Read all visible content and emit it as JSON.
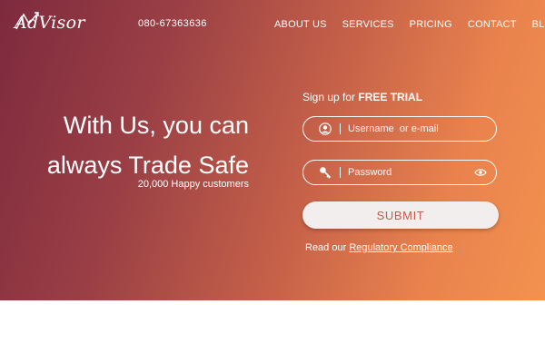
{
  "brand": {
    "logo_text": "AdVisor"
  },
  "header": {
    "phone": "080-67363636",
    "nav": [
      {
        "label": "ABOUT US"
      },
      {
        "label": "SERVICES"
      },
      {
        "label": "PRICING"
      },
      {
        "label": "CONTACT"
      },
      {
        "label": "BLOG"
      }
    ]
  },
  "hero": {
    "headline_line1": "With Us, you can",
    "headline_line2": "always Trade Safe",
    "subline": "20,000 Happy customers"
  },
  "form": {
    "signup_prefix": "Sign up for ",
    "signup_bold": "FREE TRIAL",
    "username_placeholder": "Username  or e-mail",
    "password_placeholder": "Password",
    "submit_label": "SUBMIT",
    "reg_prefix": "Read our ",
    "reg_link": "Regulatory Compliance",
    "user_icon": "user-icon",
    "key_icon": "key-icon",
    "eye_icon": "eye-icon"
  },
  "colors": {
    "gradient_start": "#7e2a3e",
    "gradient_end": "#f3924f",
    "submit_text": "#c45a4c",
    "submit_bg": "#f3eeee"
  }
}
